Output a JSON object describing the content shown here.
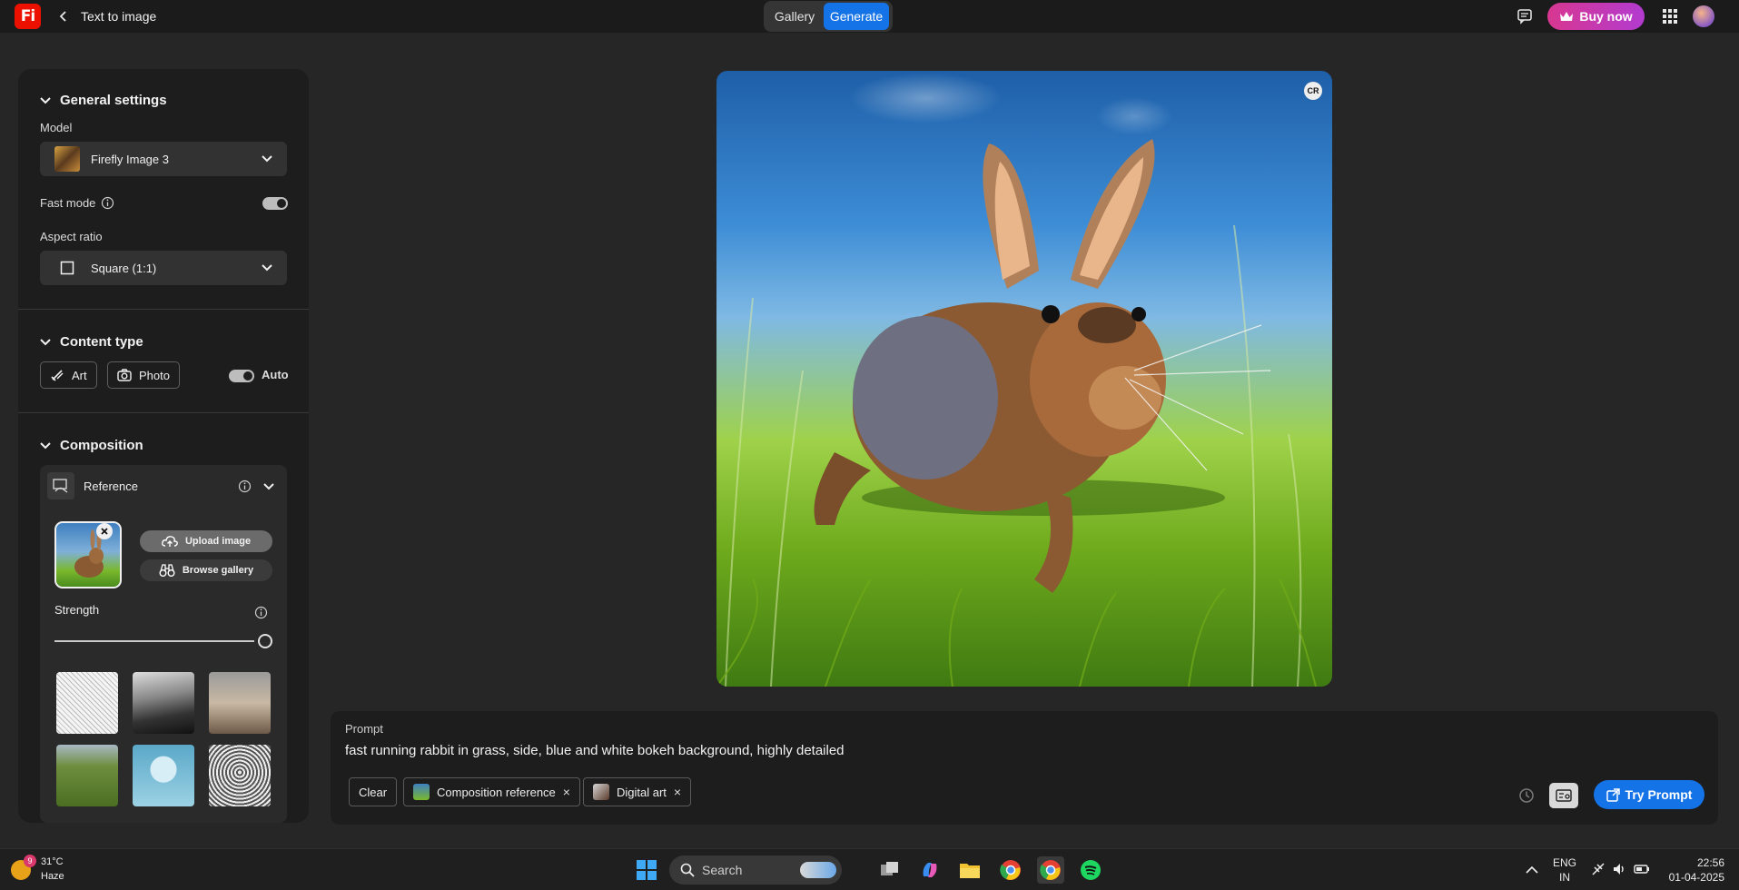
{
  "app": {
    "logo_text": "Fi",
    "page_title": "Text to image",
    "tabs": [
      {
        "label": "Gallery"
      },
      {
        "label": "Generate"
      }
    ],
    "buy_label": "Buy now",
    "accent_color": "#1473e6",
    "brand_color": "#eb1000"
  },
  "panel": {
    "general": {
      "heading": "General settings",
      "model_label": "Model",
      "model_value": "Firefly Image 3",
      "fast_mode_label": "Fast mode",
      "fast_mode_on": true,
      "aspect_label": "Aspect ratio",
      "aspect_value": "Square (1:1)"
    },
    "content": {
      "heading": "Content type",
      "art_label": "Art",
      "photo_label": "Photo",
      "auto_label": "Auto",
      "auto_on": true
    },
    "composition": {
      "heading": "Composition",
      "reference_label": "Reference",
      "upload_label": "Upload image",
      "browse_label": "Browse gallery",
      "strength_label": "Strength",
      "strength_value": 1.0,
      "presets": [
        "bird-sketch",
        "river-landscape",
        "living-room",
        "road-field",
        "sphere-cube",
        "owl-pattern"
      ]
    }
  },
  "prompt": {
    "label": "Prompt",
    "text": "fast running rabbit in grass, side, blue and white bokeh background, highly detailed",
    "clear_label": "Clear",
    "chips": [
      {
        "label": "Composition reference"
      },
      {
        "label": "Digital art"
      }
    ],
    "try_label": "Try Prompt"
  },
  "image": {
    "badge": "CR",
    "subject": "rabbit"
  },
  "taskbar": {
    "weather_temp": "31°C",
    "weather_cond": "Haze",
    "weather_badge": "9",
    "search_label": "Search",
    "lang_line1": "ENG",
    "lang_line2": "IN",
    "time": "22:56",
    "date": "01-04-2025"
  }
}
